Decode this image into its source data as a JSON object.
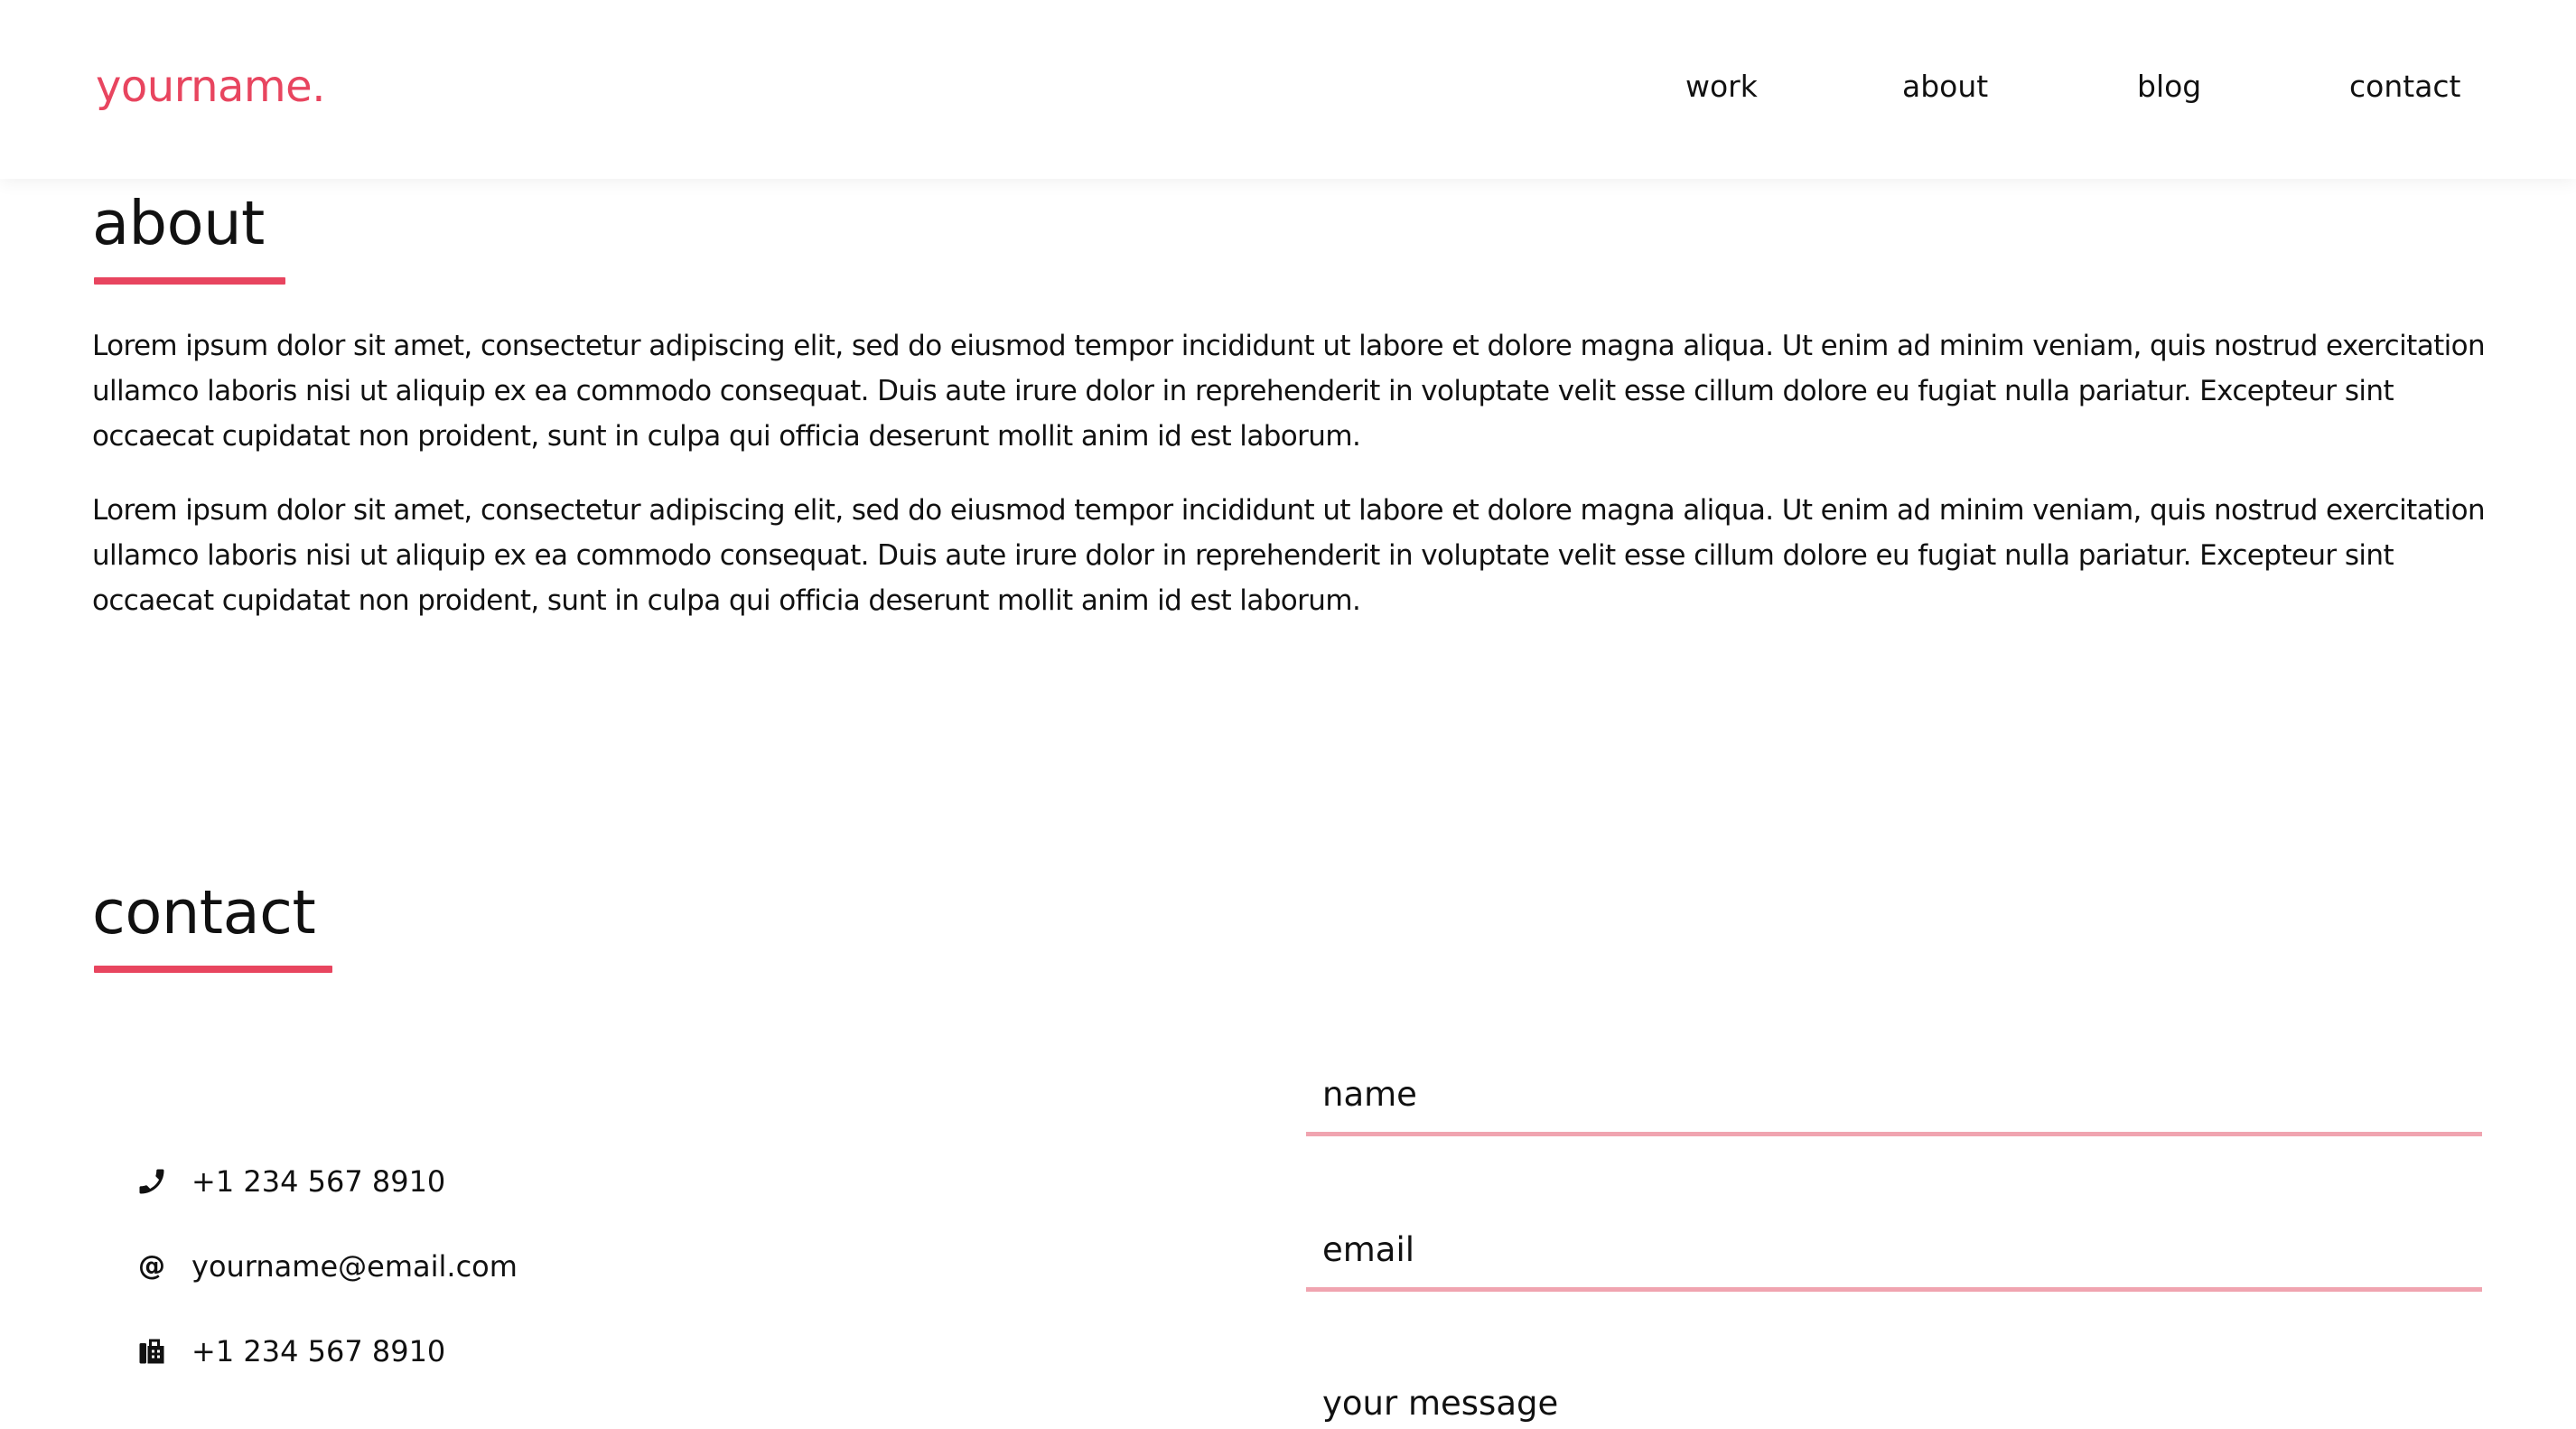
{
  "header": {
    "logo": "yourname.",
    "nav": [
      "work",
      "about",
      "blog",
      "contact"
    ]
  },
  "about": {
    "title": "about",
    "paragraphs": [
      "Lorem ipsum dolor sit amet, consectetur adipiscing elit, sed do eiusmod tempor incididunt ut labore et dolore magna aliqua. Ut enim ad minim veniam, quis nostrud exercitation ullamco laboris nisi ut aliquip ex ea commodo consequat. Duis aute irure dolor in reprehenderit in voluptate velit esse cillum dolore eu fugiat nulla pariatur. Excepteur sint occaecat cupidatat non proident, sunt in culpa qui officia deserunt mollit anim id est laborum.",
      "Lorem ipsum dolor sit amet, consectetur adipiscing elit, sed do eiusmod tempor incididunt ut labore et dolore magna aliqua. Ut enim ad minim veniam, quis nostrud exercitation ullamco laboris nisi ut aliquip ex ea commodo consequat. Duis aute irure dolor in reprehenderit in voluptate velit esse cillum dolore eu fugiat nulla pariatur. Excepteur sint occaecat cupidatat non proident, sunt in culpa qui officia deserunt mollit anim id est laborum."
    ]
  },
  "contact": {
    "title": "contact",
    "info": [
      {
        "icon": "phone-icon",
        "text": "+1 234 567 8910"
      },
      {
        "icon": "at-icon",
        "text": "yourname@email.com"
      },
      {
        "icon": "fax-icon",
        "text": "+1 234 567 8910"
      }
    ],
    "form": {
      "name_placeholder": "name",
      "email_placeholder": "email",
      "message_placeholder": "your message"
    }
  },
  "colors": {
    "accent": "#e8455f",
    "field_underline": "#f0a4b0",
    "text": "#111111",
    "background": "#ffffff"
  }
}
